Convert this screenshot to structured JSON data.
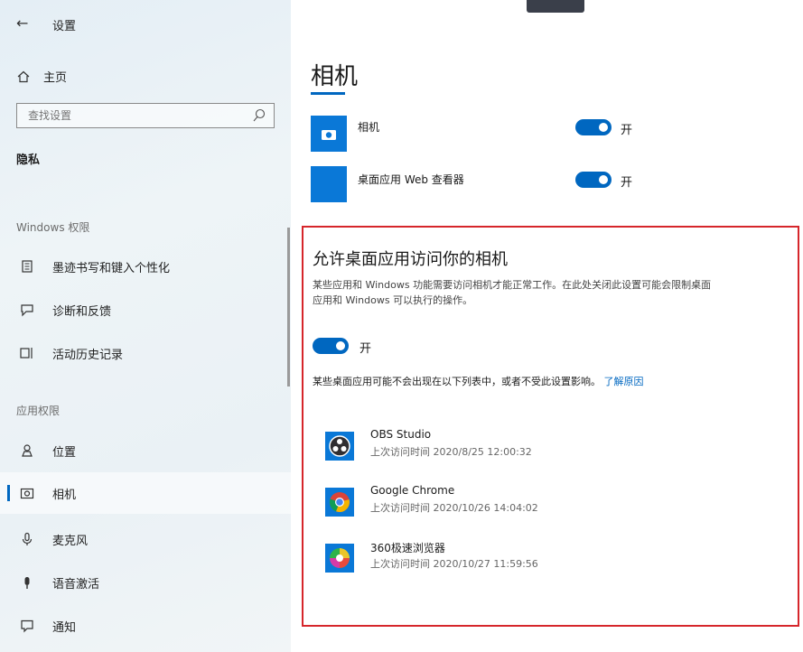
{
  "sidebar": {
    "back_glyph": "←",
    "title": "设置",
    "home": "主页",
    "search_placeholder": "查找设置",
    "section": "隐私",
    "group_windows": "Windows 权限",
    "windows_items": [
      {
        "label": "墨迹书写和键入个性化",
        "icon": "notebook-icon"
      },
      {
        "label": "诊断和反馈",
        "icon": "feedback-icon"
      },
      {
        "label": "活动历史记录",
        "icon": "timeline-icon"
      }
    ],
    "group_apps": "应用权限",
    "app_items": [
      {
        "label": "位置",
        "icon": "location-icon"
      },
      {
        "label": "相机",
        "icon": "camera-icon",
        "selected": true
      },
      {
        "label": "麦克风",
        "icon": "microphone-icon"
      },
      {
        "label": "语音激活",
        "icon": "voice-icon"
      },
      {
        "label": "通知",
        "icon": "notification-icon"
      }
    ]
  },
  "main": {
    "title": "相机",
    "apps": [
      {
        "name": "相机",
        "toggle_label": "开",
        "on": true
      },
      {
        "name": "桌面应用 Web 查看器",
        "toggle_label": "开",
        "on": true
      }
    ],
    "desktop_section": {
      "heading": "允许桌面应用访问你的相机",
      "description": "某些应用和 Windows 功能需要访问相机才能正常工作。在此处关闭此设置可能会限制桌面应用和 Windows 可以执行的操作。",
      "toggle_label": "开",
      "note": "某些桌面应用可能不会出现在以下列表中，或者不受此设置影响。",
      "learn_more": "了解原因",
      "apps": [
        {
          "name": "OBS Studio",
          "last_access": "上次访问时间 2020/8/25 12:00:32"
        },
        {
          "name": "Google Chrome",
          "last_access": "上次访问时间 2020/10/26 14:04:02"
        },
        {
          "name": "360极速浏览器",
          "last_access": "上次访问时间 2020/10/27 11:59:56"
        }
      ]
    }
  },
  "colors": {
    "accent": "#0067c0",
    "highlight_box": "#d6262b",
    "app_tile": "#0a78d7"
  }
}
